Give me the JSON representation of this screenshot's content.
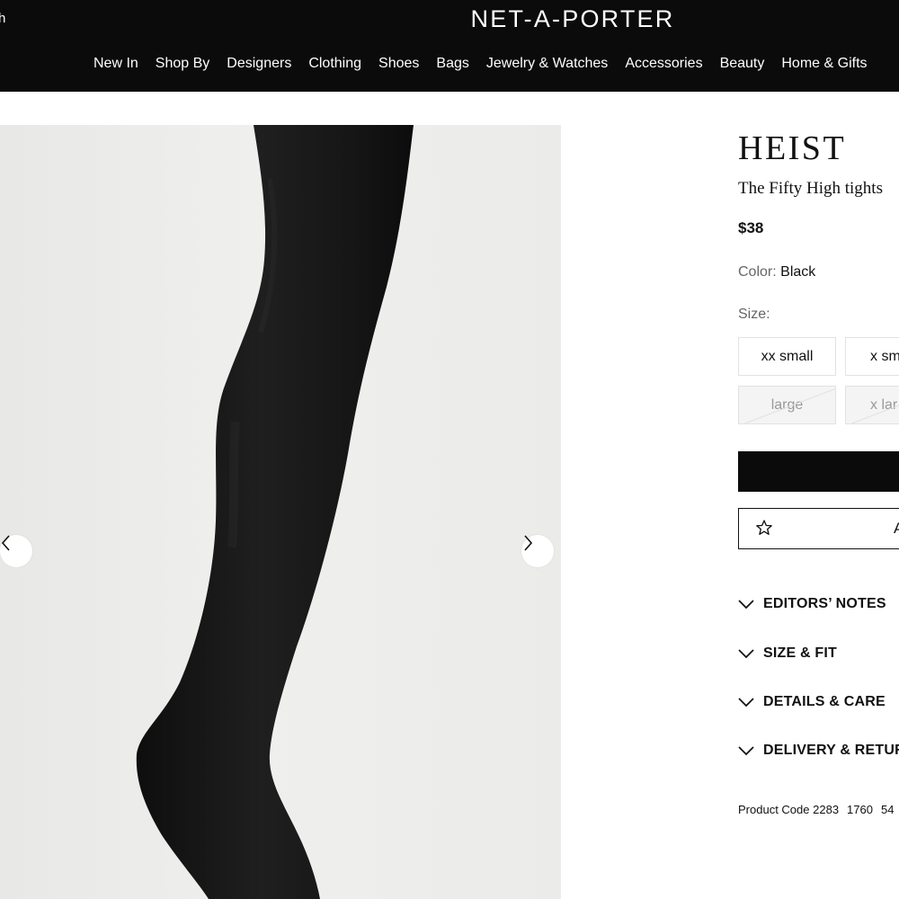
{
  "header": {
    "search_partial": "h",
    "logo": "NET-A-PORTER",
    "nav": [
      "New In",
      "Shop By",
      "Designers",
      "Clothing",
      "Shoes",
      "Bags",
      "Jewelry & Watches",
      "Accessories",
      "Beauty",
      "Home & Gifts"
    ]
  },
  "product": {
    "brand": "HEIST",
    "name": "The Fifty High tights",
    "price": "$38",
    "color_label": "Color:",
    "color_value": "Black",
    "size_label": "Size:",
    "sizes": [
      {
        "label": "xx small",
        "available": true
      },
      {
        "label": "x sm",
        "available": true
      },
      {
        "label": "large",
        "available": false
      },
      {
        "label": "x lar",
        "available": false
      }
    ],
    "wishlist_label": "A",
    "accordion": [
      "EDITORS’ NOTES",
      "SIZE & FIT",
      "DETAILS & CARE",
      "DELIVERY & RETURN"
    ],
    "product_code_label": "Product Code",
    "product_code": [
      "2283",
      "1760",
      "54"
    ]
  },
  "icons": {
    "prev": "chevron-left-icon",
    "next": "chevron-right-icon",
    "wishlist": "star-icon",
    "accordion": "chevron-down-icon"
  },
  "colors": {
    "header_bg": "#0b0b0b",
    "button_bg": "#0b0b0b",
    "image_bg": "#ececea",
    "tights": "#1a1a1a"
  }
}
